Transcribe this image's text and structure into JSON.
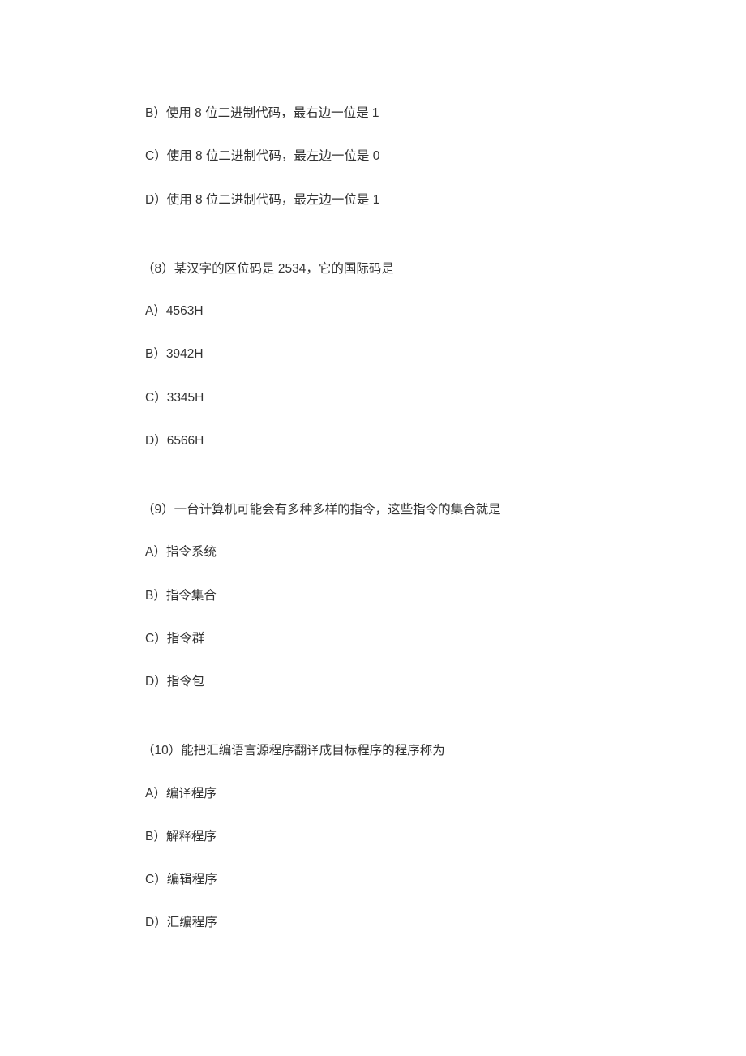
{
  "fragment": {
    "options": [
      "B）使用 8 位二进制代码，最右边一位是 1",
      "C）使用 8 位二进制代码，最左边一位是 0",
      "D）使用 8 位二进制代码，最左边一位是 1"
    ]
  },
  "q8": {
    "text": "（8）某汉字的区位码是 2534，它的国际码是",
    "options": [
      "A）4563H",
      "B）3942H",
      "C）3345H",
      "D）6566H"
    ]
  },
  "q9": {
    "text": "（9）一台计算机可能会有多种多样的指令，这些指令的集合就是",
    "options": [
      "A）指令系统",
      "B）指令集合",
      "C）指令群",
      "D）指令包"
    ]
  },
  "q10": {
    "text": "（10）能把汇编语言源程序翻译成目标程序的程序称为",
    "options": [
      "A）编译程序",
      "B）解释程序",
      "C）编辑程序",
      "D）汇编程序"
    ]
  }
}
